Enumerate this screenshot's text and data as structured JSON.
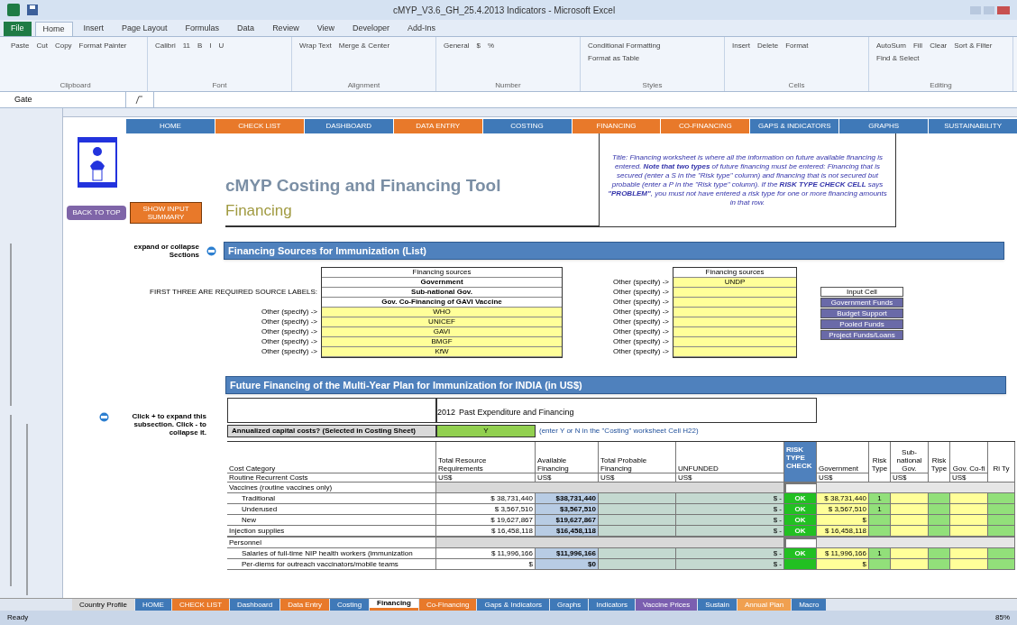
{
  "window": {
    "title": "cMYP_V3.6_GH_25.4.2013 Indicators - Microsoft Excel"
  },
  "ribbon_tabs": [
    {
      "label": "File",
      "selected": false,
      "kind": "file"
    },
    {
      "label": "Home",
      "selected": true,
      "kind": "tab"
    },
    {
      "label": "Insert",
      "selected": false,
      "kind": "tab"
    },
    {
      "label": "Page Layout",
      "selected": false,
      "kind": "tab"
    },
    {
      "label": "Formulas",
      "selected": false,
      "kind": "tab"
    },
    {
      "label": "Data",
      "selected": false,
      "kind": "tab"
    },
    {
      "label": "Review",
      "selected": false,
      "kind": "tab"
    },
    {
      "label": "View",
      "selected": false,
      "kind": "tab"
    },
    {
      "label": "Developer",
      "selected": false,
      "kind": "tab"
    },
    {
      "label": "Add-Ins",
      "selected": false,
      "kind": "tab"
    }
  ],
  "ribbon_groups": [
    {
      "label": "Clipboard",
      "items": [
        "Paste",
        "Cut",
        "Copy",
        "Format Painter"
      ]
    },
    {
      "label": "Font",
      "items": [
        "Calibri",
        "11",
        "B",
        "I",
        "U"
      ]
    },
    {
      "label": "Alignment",
      "items": [
        "Wrap Text",
        "Merge & Center"
      ]
    },
    {
      "label": "Number",
      "items": [
        "General",
        "$",
        "%"
      ]
    },
    {
      "label": "Styles",
      "items": [
        "Conditional Formatting",
        "Format as Table"
      ]
    },
    {
      "label": "Cells",
      "items": [
        "Insert",
        "Delete",
        "Format"
      ]
    },
    {
      "label": "Editing",
      "items": [
        "AutoSum",
        "Fill",
        "Clear",
        "Sort & Filter",
        "Find & Select"
      ]
    }
  ],
  "name_box": "Gate",
  "nav_tabs": [
    {
      "label": "HOME",
      "color": "#3f79b8"
    },
    {
      "label": "CHECK LIST",
      "color": "#e8792a"
    },
    {
      "label": "DASHBOARD",
      "color": "#3f79b8"
    },
    {
      "label": "DATA ENTRY",
      "color": "#e8792a"
    },
    {
      "label": "COSTING",
      "color": "#3f79b8"
    },
    {
      "label": "FINANCING",
      "color": "#e8792a"
    },
    {
      "label": "CO-FINANCING",
      "color": "#e8792a"
    },
    {
      "label": "GAPS & INDICATORS",
      "color": "#3f79b8"
    },
    {
      "label": "GRAPHS",
      "color": "#3f79b8"
    },
    {
      "label": "SUSTAINABILITY",
      "color": "#3f79b8"
    }
  ],
  "tool_title": "cMYP Costing and Financing Tool",
  "sheet_title": "Financing",
  "back_button": "BACK TO TOP",
  "summary_button": "SHOW INPUT SUMMARY",
  "note": "Title: Financing worksheet is where all the information on future available financing is entered. **Note that two types** of future financing must be entered: Financing that is secured (enter a S in the \"Risk type\" column) and financing that is not secured but probable (enter a P in the \"Risk type\" column). If the **RISK TYPE CHECK CELL** says **\"PROBLEM\"**, you must not have entered a risk type for one or more financing amounts in that row.",
  "section_toggle": "expand or collapse Sections",
  "sources_section": {
    "title": "Financing Sources for Immunization (List)",
    "required_label": "FIRST THREE ARE REQUIRED SOURCE LABELS:",
    "left_header": "Financing sources",
    "right_header": "Financing sources",
    "left": [
      {
        "name": "Government",
        "kind": "required"
      },
      {
        "name": "Sub-national Gov.",
        "kind": "required"
      },
      {
        "name": "Gov. Co-Financing of GAVI Vaccine",
        "kind": "required"
      },
      {
        "name": "WHO",
        "kind": "other",
        "label": "Other (specify) ->"
      },
      {
        "name": "UNICEF",
        "kind": "other",
        "label": "Other (specify) ->"
      },
      {
        "name": "GAVI",
        "kind": "other",
        "label": "Other (specify) ->"
      },
      {
        "name": "BMGF",
        "kind": "other",
        "label": "Other (specify) ->"
      },
      {
        "name": "KfW",
        "kind": "other",
        "label": "Other (specify) ->"
      }
    ],
    "right": [
      {
        "label": "Other (specify) ->",
        "name": "UNDP"
      },
      {
        "label": "Other (specify) ->"
      },
      {
        "label": "Other (specify) ->"
      },
      {
        "label": "Other (specify) ->"
      },
      {
        "label": "Other (specify) ->"
      },
      {
        "label": "Other (specify) ->"
      },
      {
        "label": "Other (specify) ->"
      },
      {
        "label": "Other (specify) ->"
      }
    ],
    "legend": [
      {
        "label": "Input Cell",
        "color": "#ffffff"
      },
      {
        "label": "Government Funds",
        "color": "#6a6aa8"
      },
      {
        "label": "Budget Support",
        "color": "#6a6aa8"
      },
      {
        "label": "Pooled Funds",
        "color": "#6a6aa8"
      },
      {
        "label": "Project Funds/Loans",
        "color": "#6a6aa8"
      }
    ]
  },
  "future_section": {
    "title": "Future Financing of the Multi-Year Plan for Immunization for INDIA (in US$)",
    "toggle_hint": "Click + to expand this subsection. Click - to collapse it.",
    "year": "2012",
    "period": "Past Expenditure and Financing",
    "capital_question": "Annualized capital costs? (Selected in Costing Sheet)",
    "capital_answer": "Y",
    "capital_note": "(enter Y or N in the \"Costing\" worksheet Cell H22)",
    "columns": [
      {
        "label": "Cost Category",
        "unit": "Routine Recurrent Costs"
      },
      {
        "label": "Total Resource Requirements",
        "unit": "US$"
      },
      {
        "label": "Available Financing",
        "unit": "US$"
      },
      {
        "label": "Total Probable Financing",
        "unit": "US$"
      },
      {
        "label": "UNFUNDED",
        "unit": "US$"
      },
      {
        "label": "RISK TYPE CHECK"
      },
      {
        "label": "Government",
        "unit": "US$"
      },
      {
        "label": "Risk Type"
      },
      {
        "label": "Sub-national Gov.",
        "unit": "US$"
      },
      {
        "label": "Risk Type"
      },
      {
        "label": "Gov. Co-fi",
        "unit": "US$"
      },
      {
        "label": "Ri Ty"
      }
    ],
    "rows": [
      {
        "kind": "group",
        "label": "Vaccines (routine vaccines only)"
      },
      {
        "kind": "item",
        "label": "Traditional",
        "total": "$ 38,731,440",
        "available": "$38,731,440",
        "unfunded": "$ -",
        "check": "OK",
        "government": "$ 38,731,440",
        "risk": "1"
      },
      {
        "kind": "item",
        "label": "Underused",
        "total": "$ 3,567,510",
        "available": "$3,567,510",
        "unfunded": "$ -",
        "check": "OK",
        "government": "$ 3,567,510",
        "risk": "1"
      },
      {
        "kind": "item",
        "label": "New",
        "total": "$ 19,627,867",
        "available": "$19,627,867",
        "unfunded": "$ -",
        "check": "OK",
        "government": "$"
      },
      {
        "kind": "item_flat",
        "label": "Injection supplies",
        "total": "$ 16,458,118",
        "available": "$16,458,118",
        "unfunded": "$ -",
        "check": "OK",
        "government": "$ 16,458,118"
      },
      {
        "kind": "group",
        "label": "Personnel"
      },
      {
        "kind": "item",
        "label": "Salaries of full-time NIP health workers (immunization",
        "total": "$ 11,996,166",
        "available": "$11,996,166",
        "unfunded": "$ -",
        "check": "OK",
        "government": "$ 11,996,166",
        "risk": "1"
      },
      {
        "kind": "item",
        "label": "Per-diems for outreach vaccinators/mobile teams",
        "total": "$",
        "available": "$0",
        "unfunded": "$ -",
        "government": "$"
      }
    ]
  },
  "sheet_tabs": [
    {
      "label": "Country Profile",
      "color": "#d9d9d9",
      "selected": false
    },
    {
      "label": "HOME",
      "color": "#3f79b8",
      "selected": false
    },
    {
      "label": "CHECK LIST",
      "color": "#e8792a",
      "selected": false
    },
    {
      "label": "Dashboard",
      "color": "#3f79b8",
      "selected": false
    },
    {
      "label": "Data Entry",
      "color": "#e8792a",
      "selected": false
    },
    {
      "label": "Costing",
      "color": "#3f79b8",
      "selected": false
    },
    {
      "label": "Financing",
      "color": "#e8792a",
      "selected": true
    },
    {
      "label": "Co-Financing",
      "color": "#e8792a",
      "selected": false
    },
    {
      "label": "Gaps & Indicators",
      "color": "#3f79b8",
      "selected": false
    },
    {
      "label": "Graphs",
      "color": "#3f79b8",
      "selected": false
    },
    {
      "label": "Indicators",
      "color": "#3f79b8",
      "selected": false
    },
    {
      "label": "Vaccine Prices",
      "color": "#7b5fb0",
      "selected": false
    },
    {
      "label": "Sustain",
      "color": "#3f79b8",
      "selected": false
    },
    {
      "label": "Annual Plan",
      "color": "#f0a050",
      "selected": false
    },
    {
      "label": "Macro",
      "color": "#3f79b8",
      "selected": false
    }
  ],
  "status": {
    "text": "Ready",
    "zoom": "85%"
  }
}
